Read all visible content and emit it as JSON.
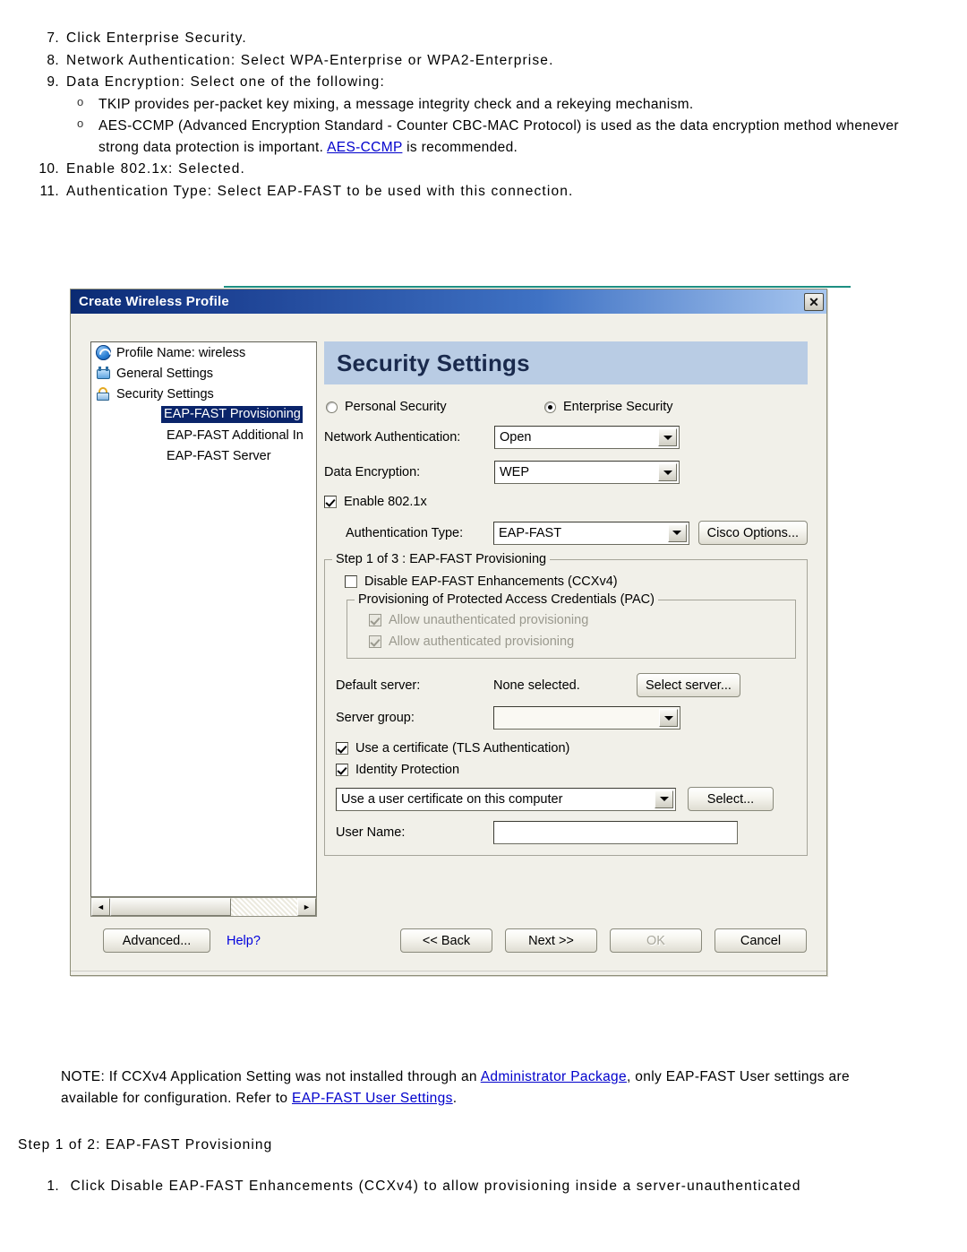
{
  "document": {
    "steps": [
      {
        "num": "7.",
        "text": "Click Enterprise Security."
      },
      {
        "num": "8.",
        "text": "Network Authentication: Select WPA-Enterprise or WPA2-Enterprise."
      },
      {
        "num": "9.",
        "text": "Data Encryption: Select one of the following:"
      }
    ],
    "substeps": [
      {
        "bullet": "o",
        "text": "TKIP provides per-packet key mixing, a message integrity check and a rekeying mechanism."
      },
      {
        "bullet": "o",
        "text_before": "AES-CCMP (Advanced Encryption Standard - Counter CBC-MAC Protocol) is used as the data encryption method whenever strong data protection is important. ",
        "link": "AES-CCMP",
        "text_after": " is recommended."
      }
    ],
    "steps_cont": [
      {
        "num": "10.",
        "text": "Enable 802.1x: Selected."
      },
      {
        "num": "11.",
        "text": "Authentication Type: Select EAP-FAST to be used with this connection."
      }
    ],
    "note": {
      "part1": "NOTE: If CCXv4 Application Setting was not installed through an ",
      "link1": "Administrator Package",
      "part2": ", only EAP-FAST User settings are available for configuration. Refer to ",
      "link2": "EAP-FAST User Settings",
      "part3": "."
    },
    "step_heading": "Step 1 of 2: EAP-FAST Provisioning",
    "final_step": {
      "num": "1.",
      "text": "Click Disable EAP-FAST Enhancements (CCXv4) to allow provisioning inside a server-unauthenticated"
    }
  },
  "dialog": {
    "title": "Create Wireless Profile",
    "close_label": "✕",
    "tree": [
      {
        "label": "Profile Name: wireless",
        "icon": "wifi-icon",
        "indent": false,
        "selected": false
      },
      {
        "label": "General Settings",
        "icon": "general-settings-icon",
        "indent": false,
        "selected": false
      },
      {
        "label": "Security Settings",
        "icon": "lock-icon",
        "indent": false,
        "selected": false
      },
      {
        "label": "EAP-FAST Provisioning",
        "icon": "",
        "indent": true,
        "selected": true
      },
      {
        "label": "EAP-FAST Additional In",
        "icon": "",
        "indent": true,
        "selected": false
      },
      {
        "label": "EAP-FAST Server",
        "icon": "",
        "indent": true,
        "selected": false
      }
    ],
    "scroll_left": "◄",
    "scroll_right": "►",
    "banner_title": "Security Settings",
    "security_mode": {
      "personal_label": "Personal Security",
      "personal_selected": false,
      "enterprise_label": "Enterprise Security",
      "enterprise_selected": true
    },
    "network_auth": {
      "label": "Network Authentication:",
      "value": "Open"
    },
    "data_encryption": {
      "label": "Data Encryption:",
      "value": "WEP"
    },
    "enable_8021x": {
      "label": "Enable 802.1x",
      "checked": true
    },
    "auth_type": {
      "label": "Authentication Type:",
      "value": "EAP-FAST"
    },
    "cisco_options_button": "Cisco Options...",
    "provisioning_group": {
      "title": "Step 1 of 3 : EAP-FAST Provisioning",
      "disable_enhancements": {
        "label": "Disable EAP-FAST Enhancements (CCXv4)",
        "checked": false
      },
      "pac_group": {
        "title": "Provisioning of Protected Access Credentials (PAC)",
        "items": [
          {
            "label": "Allow unauthenticated provisioning",
            "checked": true,
            "disabled": true
          },
          {
            "label": "Allow authenticated provisioning",
            "checked": true,
            "disabled": true
          }
        ]
      },
      "default_server": {
        "label": "Default server:",
        "value": "None selected.",
        "button": "Select server..."
      },
      "server_group": {
        "label": "Server group:",
        "value": ""
      },
      "use_certificate": {
        "label": "Use a certificate (TLS Authentication)",
        "checked": true
      },
      "identity_protection": {
        "label": "Identity Protection",
        "checked": true
      },
      "cert_source": {
        "value": "Use a user certificate on this computer",
        "button": "Select..."
      },
      "user_name": {
        "label": "User Name:",
        "value": ""
      }
    },
    "footer": {
      "advanced_button": "Advanced...",
      "help_link": "Help?",
      "back_button": "<< Back",
      "next_button": "Next >>",
      "ok_button": "OK",
      "cancel_button": "Cancel"
    }
  },
  "colors": {
    "titlebar_start": "#0a2a72",
    "titlebar_end": "#a7c6ef",
    "banner": "#b9cce4",
    "selection": "#0a246a",
    "link": "#0000cc",
    "dialog_face": "#f1f0e9",
    "teal_rule": "#1d8f82"
  }
}
